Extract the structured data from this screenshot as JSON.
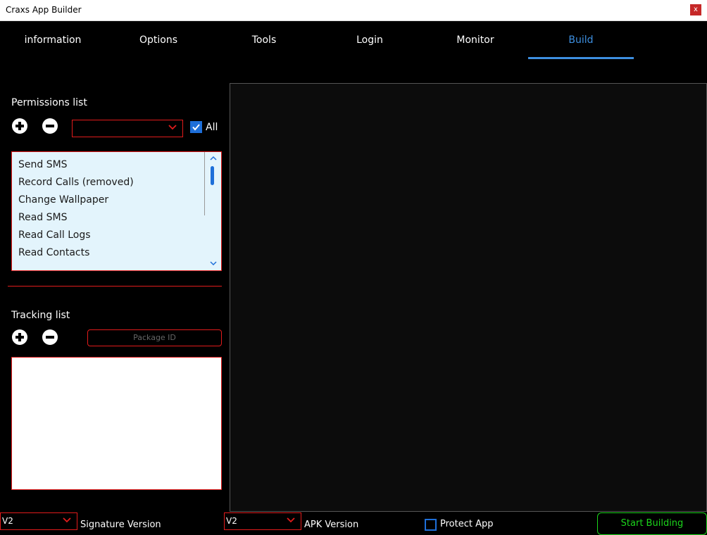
{
  "window": {
    "title": "Craxs App Builder",
    "close_label": "x"
  },
  "tabs": [
    {
      "label": "information"
    },
    {
      "label": "Options"
    },
    {
      "label": "Tools"
    },
    {
      "label": "Login"
    },
    {
      "label": "Monitor"
    },
    {
      "label": "Build",
      "active": true
    }
  ],
  "permissions": {
    "title": "Permissions list",
    "add_icon": "plus-circle-icon",
    "remove_icon": "minus-circle-icon",
    "dropdown_value": "",
    "all_checked": true,
    "all_label": "All",
    "items": [
      "Send SMS",
      "Record Calls (removed)",
      "Change Wallpaper",
      "Read SMS",
      "Read Call Logs",
      "Read Contacts"
    ]
  },
  "tracking": {
    "title": "Tracking list",
    "package_placeholder": "Package ID",
    "items": []
  },
  "bottom": {
    "signature_value": "V2",
    "signature_label": "Signature Version",
    "apk_value": "V2",
    "apk_label": "APK Version",
    "protect_label": "Protect App",
    "protect_checked": false,
    "start_label": "Start Building"
  },
  "colors": {
    "accent": "#3d8fe0",
    "border_red": "#e21b1b",
    "start_green": "#1bd51b",
    "list_bg": "#e3f4fc"
  }
}
